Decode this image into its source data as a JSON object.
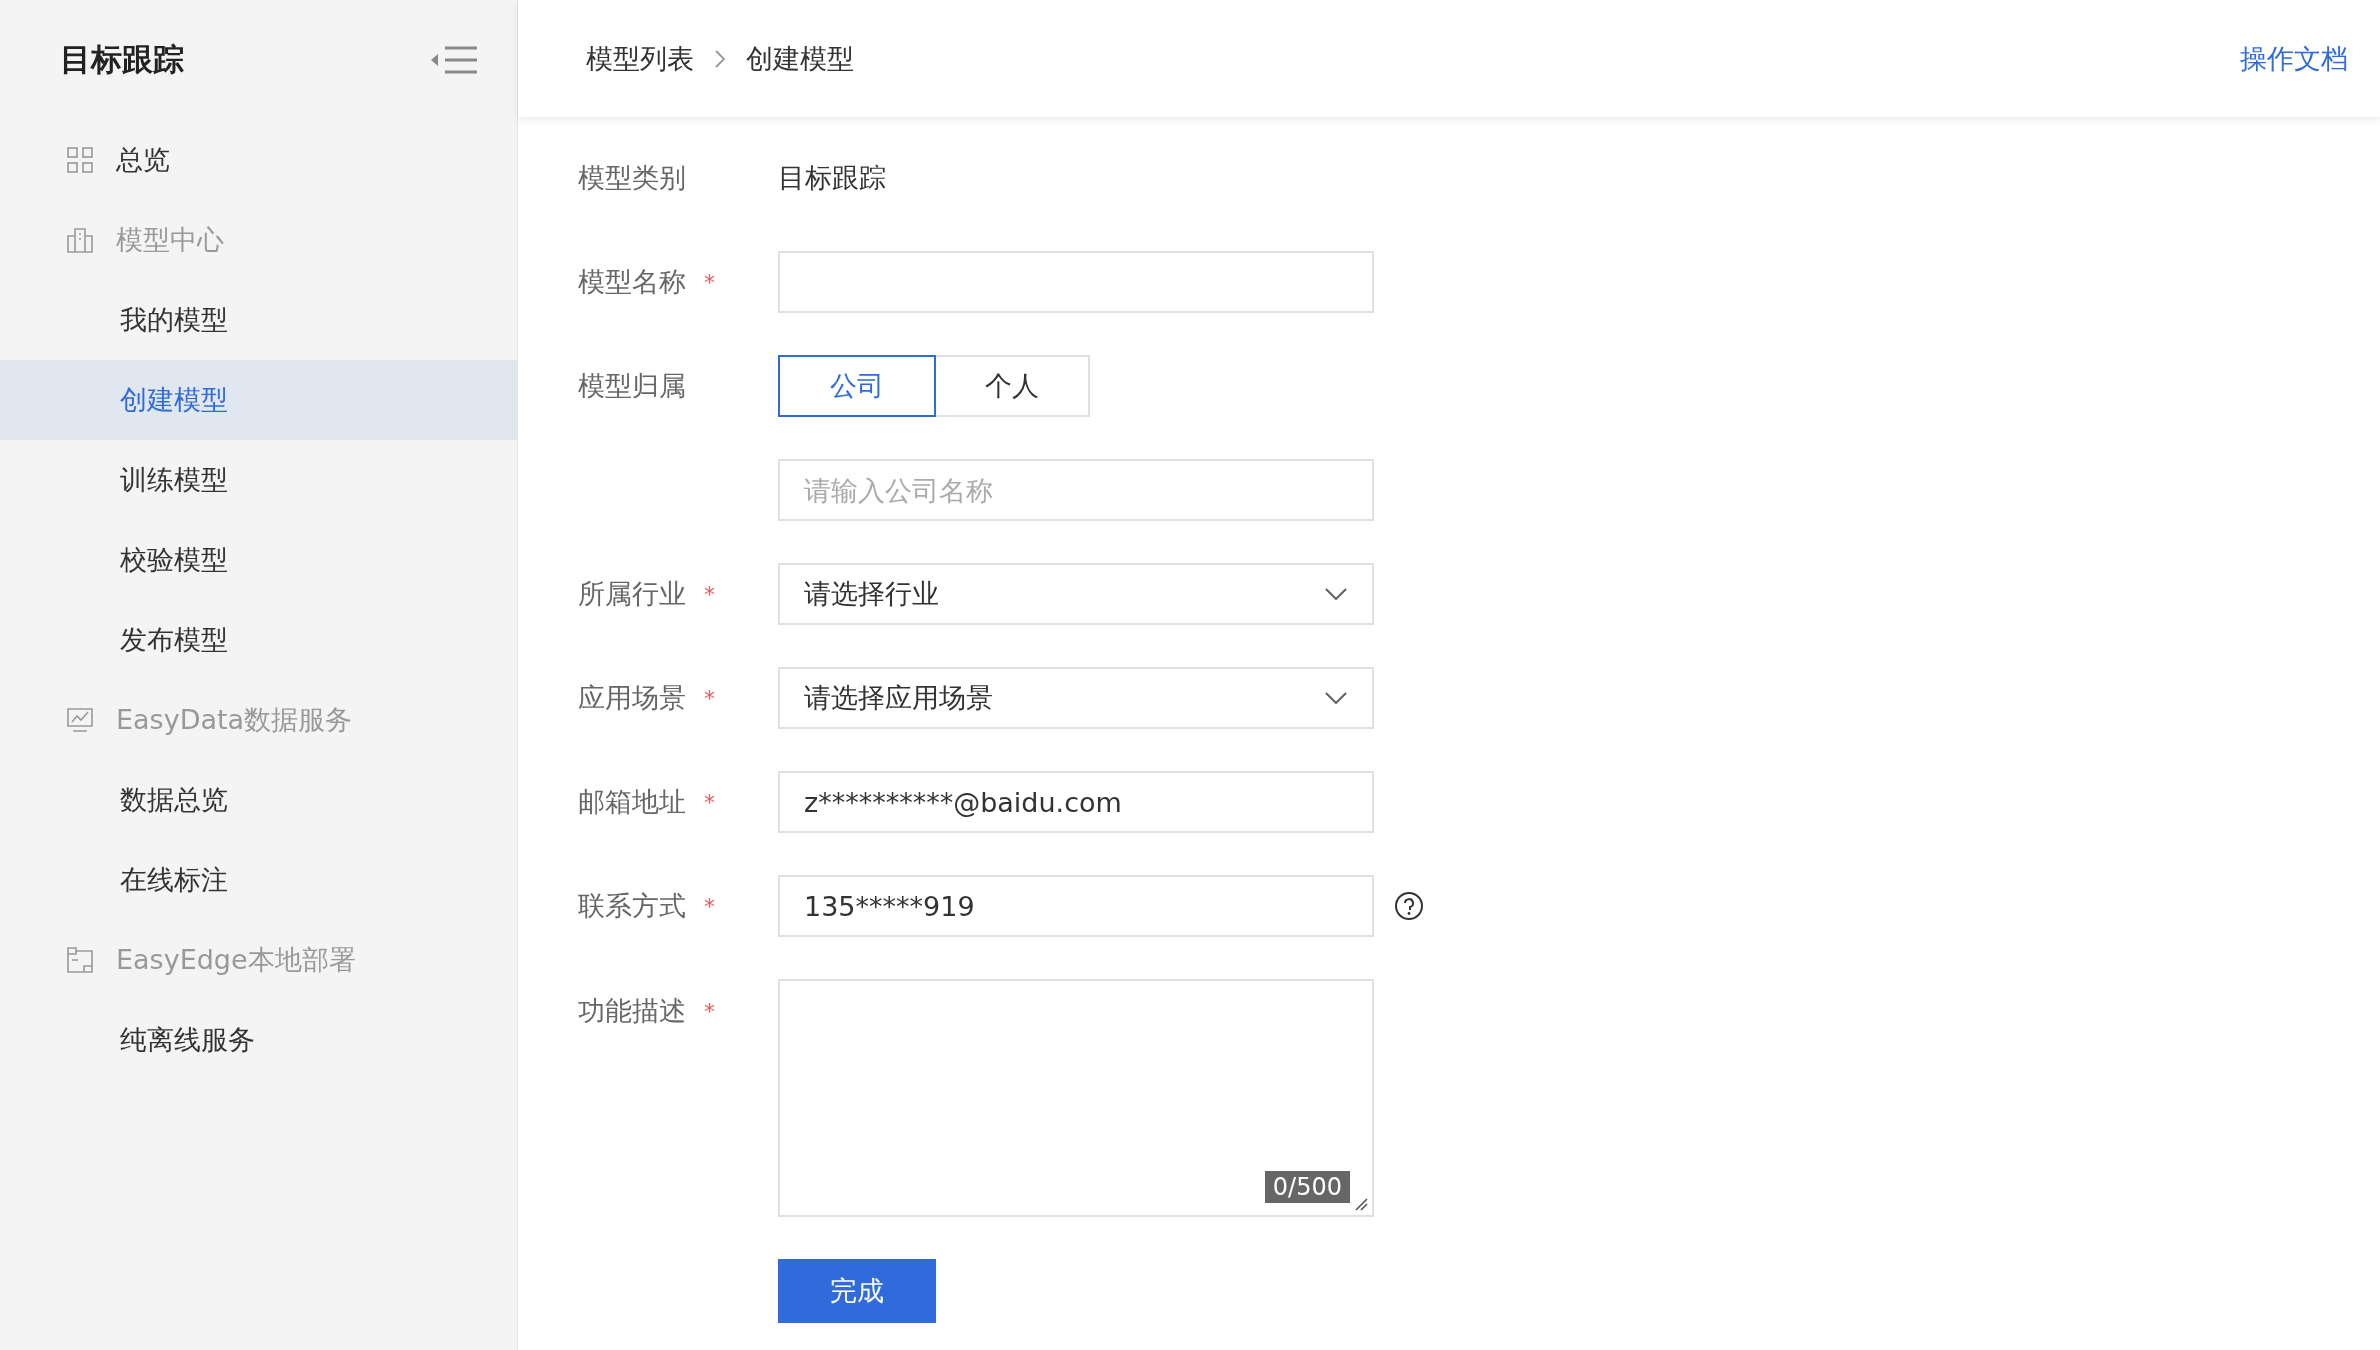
{
  "sidebar": {
    "title": "目标跟踪",
    "items": [
      {
        "kind": "link",
        "label": "总览",
        "selected": false
      },
      {
        "kind": "group",
        "label": "模型中心",
        "children": [
          {
            "label": "我的模型",
            "selected": false
          },
          {
            "label": "创建模型",
            "selected": true
          },
          {
            "label": "训练模型",
            "selected": false
          },
          {
            "label": "校验模型",
            "selected": false
          },
          {
            "label": "发布模型",
            "selected": false
          }
        ]
      },
      {
        "kind": "group",
        "label": "EasyData数据服务",
        "children": [
          {
            "label": "数据总览",
            "selected": false
          },
          {
            "label": "在线标注",
            "selected": false
          }
        ]
      },
      {
        "kind": "group",
        "label": "EasyEdge本地部署",
        "children": [
          {
            "label": "纯离线服务",
            "selected": false
          }
        ]
      }
    ]
  },
  "header": {
    "breadcrumb": [
      "模型列表",
      "创建模型"
    ],
    "doc_link": "操作文档"
  },
  "form": {
    "rows": [
      {
        "kind": "static",
        "label": "模型类别",
        "value": "目标跟踪"
      },
      {
        "kind": "input",
        "label": "模型名称",
        "required_mark": "*"
      },
      {
        "kind": "segmented",
        "label": "模型归属",
        "options": [
          {
            "label": "公司",
            "selected": true
          },
          {
            "label": "个人",
            "selected": false
          }
        ]
      },
      {
        "kind": "input",
        "placeholder": "请输入公司名称"
      },
      {
        "kind": "select",
        "label": "所属行业",
        "required_mark": "*",
        "value": "请选择行业"
      },
      {
        "kind": "select",
        "label": "应用场景",
        "required_mark": "*",
        "value": "请选择应用场景"
      },
      {
        "kind": "input",
        "label": "邮箱地址",
        "required_mark": "*",
        "value": "z**********@baidu.com"
      },
      {
        "kind": "input",
        "label": "联系方式",
        "required_mark": "*",
        "value": "135*****919",
        "help": true
      },
      {
        "kind": "textarea",
        "label": "功能描述",
        "required_mark": "*",
        "counter": "0/500"
      }
    ],
    "submit": "完成"
  }
}
